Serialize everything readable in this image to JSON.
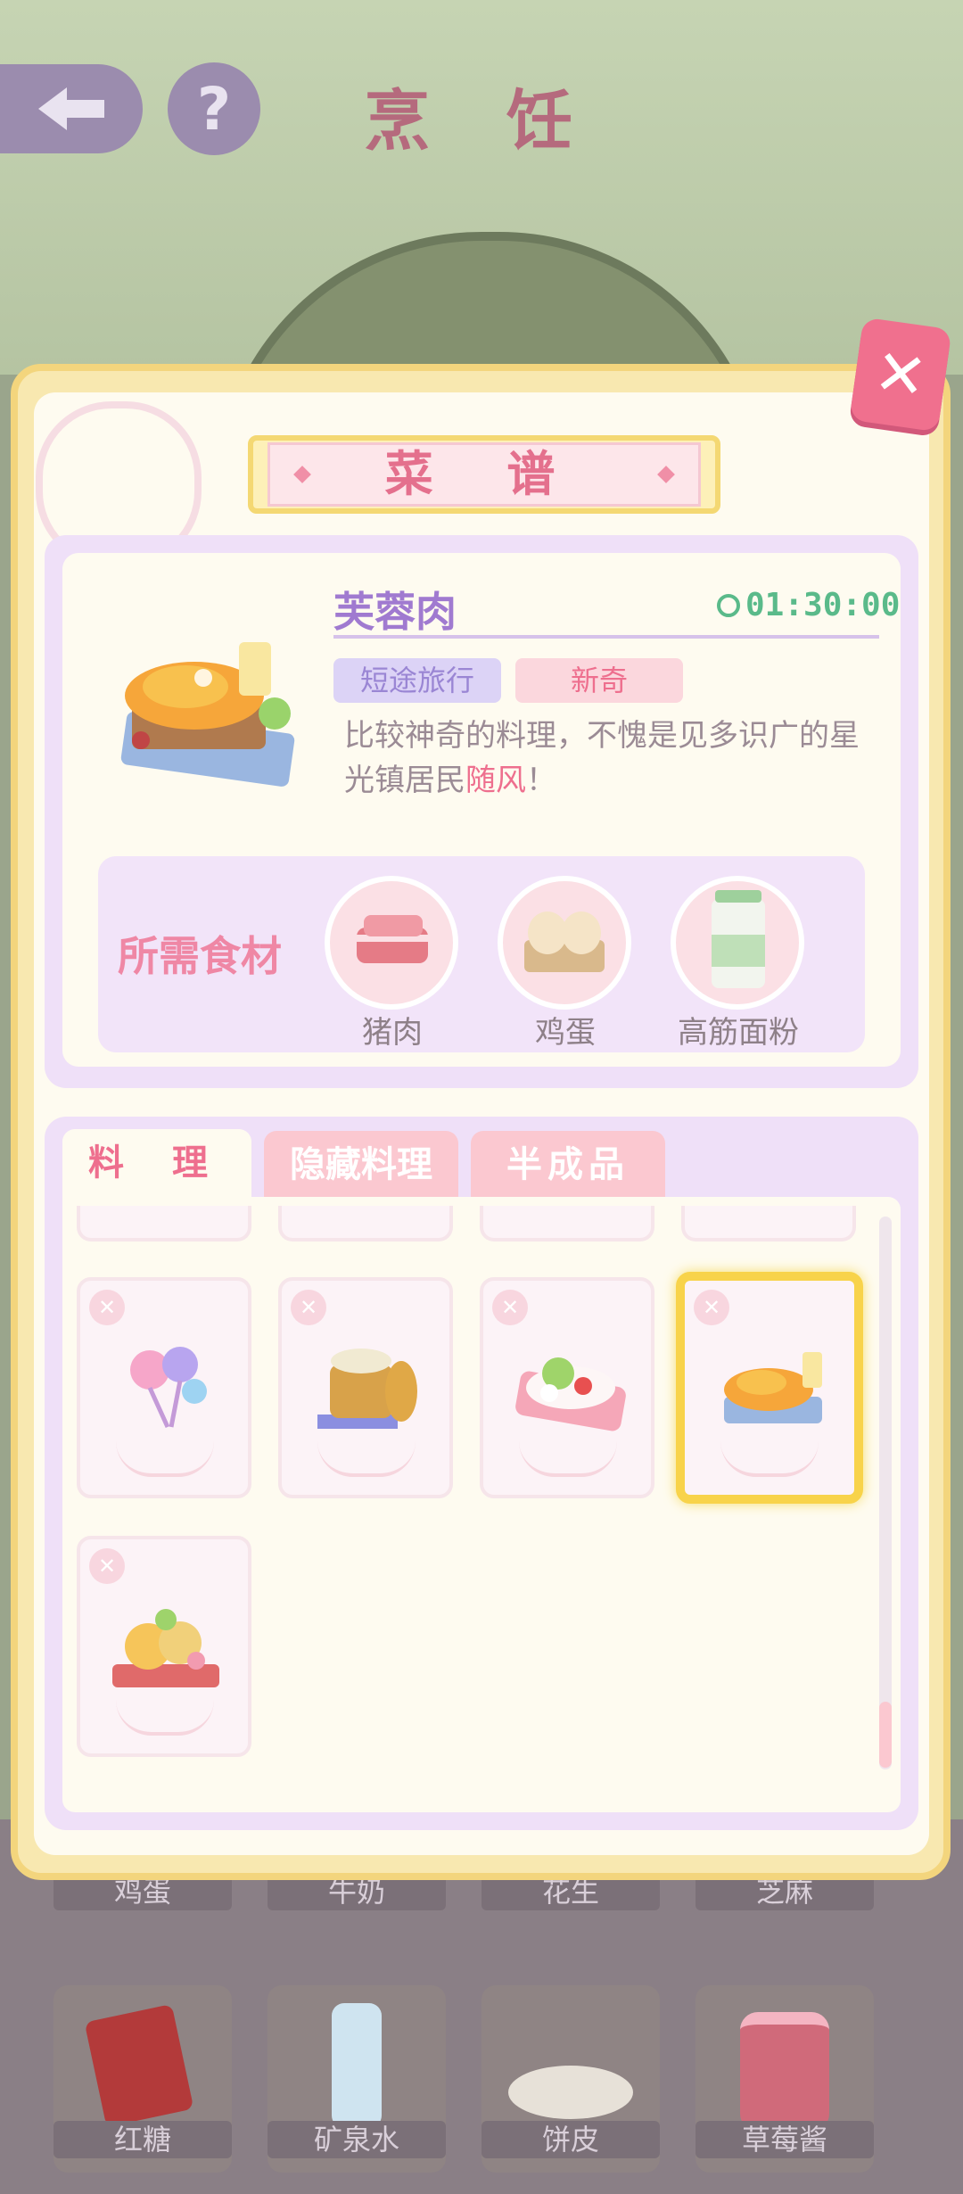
{
  "scene": {
    "title": "烹 饪",
    "back_icon": "back-arrow-icon",
    "help_label": "?"
  },
  "modal": {
    "title": "菜 谱",
    "close_label": "✕"
  },
  "recipe": {
    "name": "芙蓉肉",
    "timer": "01:30:00",
    "tags": [
      "短途旅行",
      "新奇"
    ],
    "desc_part1": "比较神奇的料理，不愧是见多识广的星光镇居民",
    "desc_highlight": "随风",
    "desc_end": "！",
    "ingredients_title": "所需食材",
    "ingredients": [
      "猪肉",
      "鸡蛋",
      "高筋面粉"
    ]
  },
  "tabs": [
    "料 理",
    "隐藏料理",
    "半成品"
  ],
  "dish_cards": [
    {
      "icon": "lollipop-icon",
      "selected": false
    },
    {
      "icon": "steamed-buns-icon",
      "selected": false
    },
    {
      "icon": "salad-plate-icon",
      "selected": false
    },
    {
      "icon": "fried-pork-dish-icon",
      "selected": true
    },
    {
      "icon": "fruit-pastry-icon",
      "selected": false
    }
  ],
  "background_items": {
    "row1": [
      "鸡蛋",
      "牛奶",
      "花生",
      "芝麻"
    ],
    "row2": [
      "红糖",
      "矿泉水",
      "饼皮",
      "草莓酱"
    ]
  },
  "colors": {
    "accent_pink": "#ee6f8e",
    "accent_purple": "#a07ad0",
    "timer_green": "#5aba8a",
    "selection_gold": "#f8d34a"
  }
}
